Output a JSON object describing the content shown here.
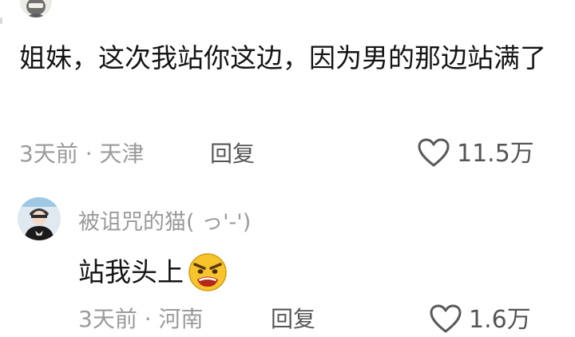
{
  "top_comment": {
    "text": "姐妹，这次我站你这边，因为男的那边站满了",
    "meta": "3天前 · 天津",
    "reply_label": "回复",
    "like_count": "11.5万",
    "avatar_icon": "ninja-avatar-icon"
  },
  "reply_comment": {
    "username": "被诅咒的猫( っ'-')",
    "text": "站我头上",
    "emoji_icon": "angry-face-emoji",
    "meta": "3天前 · 河南",
    "reply_label": "回复",
    "like_count": "1.6万"
  },
  "colors": {
    "text_primary": "#141414",
    "text_meta": "#9b9b9b",
    "reply_action": "#565656",
    "like_count": "#555555"
  }
}
